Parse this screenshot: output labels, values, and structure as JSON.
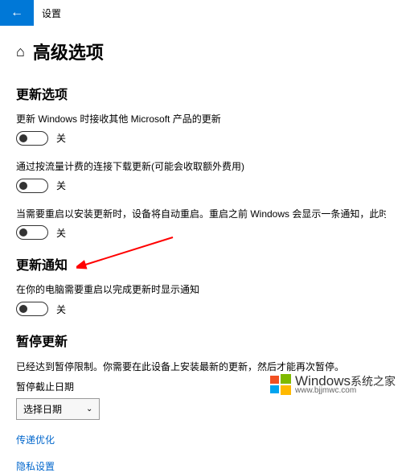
{
  "titlebar": {
    "label": "设置"
  },
  "page": {
    "title": "高级选项"
  },
  "sections": {
    "update_options": {
      "title": "更新选项",
      "items": [
        {
          "label": "更新 Windows 时接收其他 Microsoft 产品的更新",
          "state": "关"
        },
        {
          "label": "通过按流量计费的连接下载更新(可能会收取额外费用)",
          "state": "关"
        },
        {
          "label": "当需要重启以安装更新时，设备将自动重启。重启之前 Windows 会显示一条通知，此时设备必须处于开启和电源供电状态",
          "state": "关"
        }
      ]
    },
    "update_notify": {
      "title": "更新通知",
      "items": [
        {
          "label": "在你的电脑需要重启以完成更新时显示通知",
          "state": "关"
        }
      ]
    },
    "pause": {
      "title": "暂停更新",
      "desc": "已经达到暂停限制。你需要在此设备上安装最新的更新，然后才能再次暂停。",
      "date_label": "暂停截止日期",
      "select_placeholder": "选择日期"
    }
  },
  "links": {
    "delivery_opt": "传递优化",
    "privacy": "隐私设置"
  },
  "watermark": {
    "main": "Windows",
    "sub": "系统之家",
    "url": "www.bjjmwc.com"
  }
}
